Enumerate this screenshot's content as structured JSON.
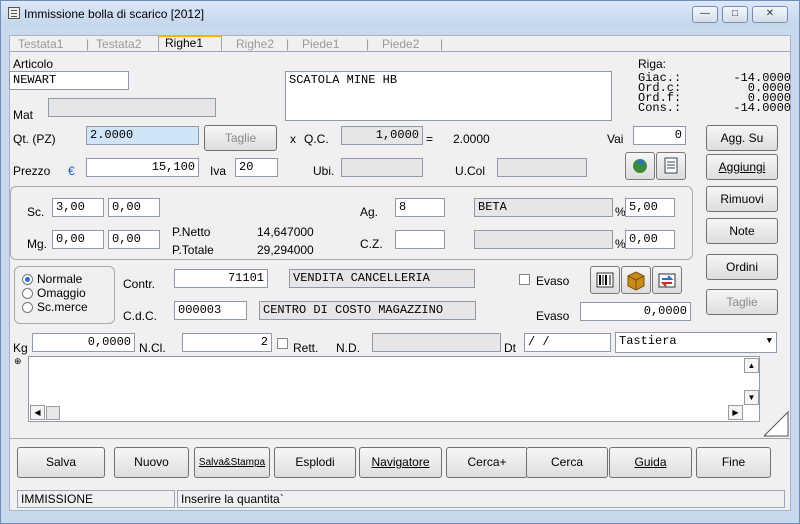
{
  "window": {
    "title": "Immissione bolla di scarico [2012]"
  },
  "tabs": [
    {
      "label": "Testata1"
    },
    {
      "label": "Testata2"
    },
    {
      "label": "Righe1"
    },
    {
      "label": "Righe2"
    },
    {
      "label": "Piede1"
    },
    {
      "label": "Piede2"
    }
  ],
  "articolo": {
    "label": "Articolo",
    "code": "NEWART",
    "description": "SCATOLA MINE HB"
  },
  "mat": {
    "label": "Mat",
    "value": ""
  },
  "riga": {
    "label": "Riga:",
    "rows": [
      {
        "label": "Giac.:",
        "value": "-14.0000"
      },
      {
        "label": "Ord.c:",
        "value": "0.0000"
      },
      {
        "label": "Ord.f:",
        "value": "0.0000"
      },
      {
        "label": "Cons.:",
        "value": "-14.0000"
      }
    ]
  },
  "qta": {
    "label": "Qt. (PZ)",
    "value": "2.0000",
    "taglie_label": "Taglie",
    "x_label": "x",
    "qc_label": "Q.C.",
    "qc_value": "1,0000",
    "eq_label": "=",
    "result": "2.0000"
  },
  "vai": {
    "label": "Vai",
    "value": "0"
  },
  "prezzo": {
    "label": "Prezzo",
    "currency": "€",
    "value": "15,100",
    "iva_label": "Iva",
    "iva_value": "20",
    "ubi_label": "Ubi.",
    "ubi_value": "",
    "ucol_label": "U.Col",
    "ucol_value": ""
  },
  "sconti": {
    "sc_label": "Sc.",
    "sc1": "3,00",
    "sc2": "0,00",
    "mg_label": "Mg.",
    "mg1": "0,00",
    "mg2": "0,00",
    "pnetto_label": "P.Netto",
    "pnetto_value": "14,647000",
    "ptotale_label": "P.Totale",
    "ptotale_value": "29,294000",
    "ag_label": "Ag.",
    "ag_code": "8",
    "ag_name": "BETA",
    "ag_perc_symbol": "%",
    "ag_perc": "5,00",
    "cz_label": "C.Z.",
    "cz_code": "",
    "cz_name": "",
    "cz_perc_symbol": "%",
    "cz_perc": "0,00"
  },
  "tipo": {
    "options": [
      {
        "label": "Normale",
        "selected": true
      },
      {
        "label": "Omaggio",
        "selected": false
      },
      {
        "label": "Sc.merce",
        "selected": false
      }
    ]
  },
  "contr": {
    "label": "Contr.",
    "code": "71101",
    "name": "VENDITA CANCELLERIA",
    "evaso_label": "Evaso"
  },
  "cdc": {
    "label": "C.d.C.",
    "code": "000003",
    "name": "CENTRO DI COSTO MAGAZZINO",
    "evaso_label": "Evaso",
    "evaso_value": "0,0000"
  },
  "kg": {
    "label": "Kg",
    "value": "0,0000",
    "ncl_label": "N.Cl.",
    "ncl_value": "2",
    "rett_label": "Rett.",
    "nd_label": "N.D.",
    "nd_value": "",
    "dt_label": "Dt",
    "dt_value": " /  /",
    "combo_value": "Tastiera"
  },
  "side_buttons": {
    "agg_su": "Agg. Su",
    "aggiungi": "Aggiungi",
    "rimuovi": "Rimuovi",
    "note": "Note",
    "ordini": "Ordini",
    "taglie": "Taglie"
  },
  "memo": {
    "text": ""
  },
  "bottom_buttons": [
    "Salva",
    "Nuovo",
    "Salva&Stampa",
    "Esplodi",
    "Navigatore",
    "Cerca+",
    "Cerca",
    "Guida",
    "Fine"
  ],
  "status": {
    "mode": "IMMISSIONE",
    "message": "Inserire la quantita`"
  },
  "colors": {
    "accent_tab": "#f4b400",
    "qty_field": "#cfe5f7",
    "window_frame": "#c8d9ee"
  }
}
